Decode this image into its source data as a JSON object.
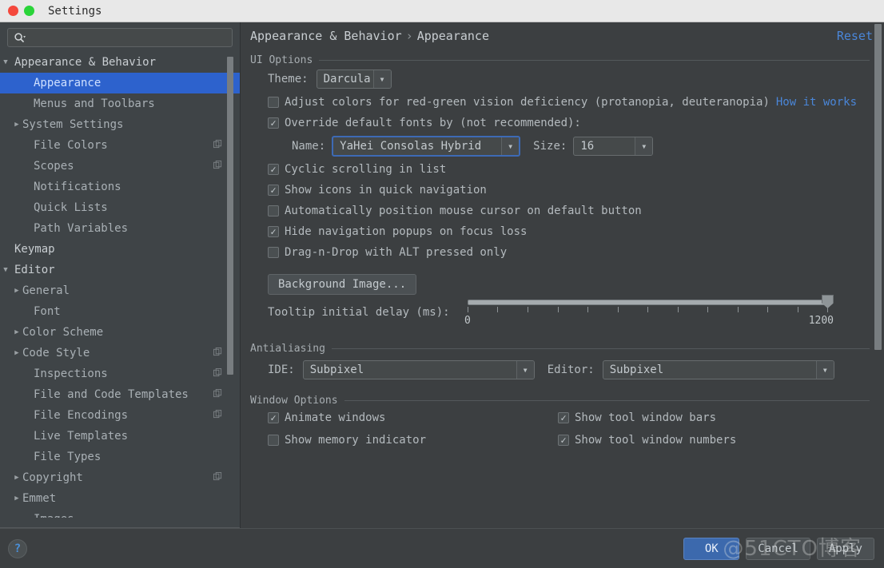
{
  "window": {
    "title": "Settings",
    "close_dot": "red-dot",
    "maximize_dot": "green-dot"
  },
  "sidebar": {
    "search": {
      "value": "",
      "placeholder": ""
    },
    "items": [
      {
        "label": "Appearance & Behavior",
        "level": 0,
        "arrow": "down",
        "selected": false,
        "copy": false
      },
      {
        "label": "Appearance",
        "level": 1,
        "arrow": "none",
        "selected": true,
        "copy": false
      },
      {
        "label": "Menus and Toolbars",
        "level": 1,
        "arrow": "none",
        "selected": false,
        "copy": false
      },
      {
        "label": "System Settings",
        "level": 1,
        "arrow": "right",
        "selected": false,
        "copy": false
      },
      {
        "label": "File Colors",
        "level": 1,
        "arrow": "none",
        "selected": false,
        "copy": true
      },
      {
        "label": "Scopes",
        "level": 1,
        "arrow": "none",
        "selected": false,
        "copy": true
      },
      {
        "label": "Notifications",
        "level": 1,
        "arrow": "none",
        "selected": false,
        "copy": false
      },
      {
        "label": "Quick Lists",
        "level": 1,
        "arrow": "none",
        "selected": false,
        "copy": false
      },
      {
        "label": "Path Variables",
        "level": 1,
        "arrow": "none",
        "selected": false,
        "copy": false
      },
      {
        "label": "Keymap",
        "level": 0,
        "arrow": "none",
        "selected": false,
        "copy": false
      },
      {
        "label": "Editor",
        "level": 0,
        "arrow": "down",
        "selected": false,
        "copy": false
      },
      {
        "label": "General",
        "level": 1,
        "arrow": "right",
        "selected": false,
        "copy": false
      },
      {
        "label": "Font",
        "level": 1,
        "arrow": "none",
        "selected": false,
        "copy": false
      },
      {
        "label": "Color Scheme",
        "level": 1,
        "arrow": "right",
        "selected": false,
        "copy": false
      },
      {
        "label": "Code Style",
        "level": 1,
        "arrow": "right",
        "selected": false,
        "copy": true
      },
      {
        "label": "Inspections",
        "level": 1,
        "arrow": "none",
        "selected": false,
        "copy": true
      },
      {
        "label": "File and Code Templates",
        "level": 1,
        "arrow": "none",
        "selected": false,
        "copy": true
      },
      {
        "label": "File Encodings",
        "level": 1,
        "arrow": "none",
        "selected": false,
        "copy": true
      },
      {
        "label": "Live Templates",
        "level": 1,
        "arrow": "none",
        "selected": false,
        "copy": false
      },
      {
        "label": "File Types",
        "level": 1,
        "arrow": "none",
        "selected": false,
        "copy": false
      },
      {
        "label": "Copyright",
        "level": 1,
        "arrow": "right",
        "selected": false,
        "copy": true
      },
      {
        "label": "Emmet",
        "level": 1,
        "arrow": "right",
        "selected": false,
        "copy": false
      },
      {
        "label": "Images",
        "level": 1,
        "arrow": "none",
        "selected": false,
        "copy": false
      }
    ]
  },
  "header": {
    "breadcrumb_parent": "Appearance & Behavior",
    "breadcrumb_separator": "›",
    "breadcrumb_current": "Appearance",
    "reset_label": "Reset"
  },
  "ui_options": {
    "group_title": "UI Options",
    "theme_label": "Theme:",
    "theme_value": "Darcula",
    "adjust_colors_label": "Adjust colors for red-green vision deficiency (protanopia, deuteranopia)",
    "adjust_colors_checked": false,
    "how_it_works_link": "How it works",
    "override_fonts_label": "Override default fonts by (not recommended):",
    "override_fonts_checked": true,
    "name_label": "Name:",
    "name_value": "YaHei Consolas Hybrid",
    "size_label": "Size:",
    "size_value": "16",
    "cyclic_scrolling_label": "Cyclic scrolling in list",
    "cyclic_scrolling_checked": true,
    "show_icons_label": "Show icons in quick navigation",
    "show_icons_checked": true,
    "auto_position_label": "Automatically position mouse cursor on default button",
    "auto_position_checked": false,
    "hide_nav_popups_label": "Hide navigation popups on focus loss",
    "hide_nav_popups_checked": true,
    "drag_drop_label": "Drag-n-Drop with ALT pressed only",
    "drag_drop_checked": false,
    "background_image_button": "Background Image...",
    "tooltip_delay_label": "Tooltip initial delay (ms):",
    "tooltip_delay_min": "0",
    "tooltip_delay_max": "1200",
    "tooltip_delay_value": "1200"
  },
  "antialiasing": {
    "group_title": "Antialiasing",
    "ide_label": "IDE:",
    "ide_value": "Subpixel",
    "editor_label": "Editor:",
    "editor_value": "Subpixel"
  },
  "window_options": {
    "group_title": "Window Options",
    "animate_windows_label": "Animate windows",
    "animate_windows_checked": true,
    "show_memory_label": "Show memory indicator",
    "show_memory_checked": false,
    "show_tool_bars_label": "Show tool window bars",
    "show_tool_bars_checked": true,
    "show_tool_numbers_label": "Show tool window numbers",
    "show_tool_numbers_checked": true
  },
  "footer": {
    "help_icon": "question-mark-icon",
    "ok_label": "OK",
    "cancel_label": "Cancel",
    "apply_label": "Apply"
  },
  "watermark": "@51CTO博客",
  "colors": {
    "accent_blue": "#2d62cd",
    "link_blue": "#4a86d8",
    "panel_bg": "#3c3f41",
    "sidebar_bg": "#3f4447",
    "primary_button": "#3c69ad"
  }
}
